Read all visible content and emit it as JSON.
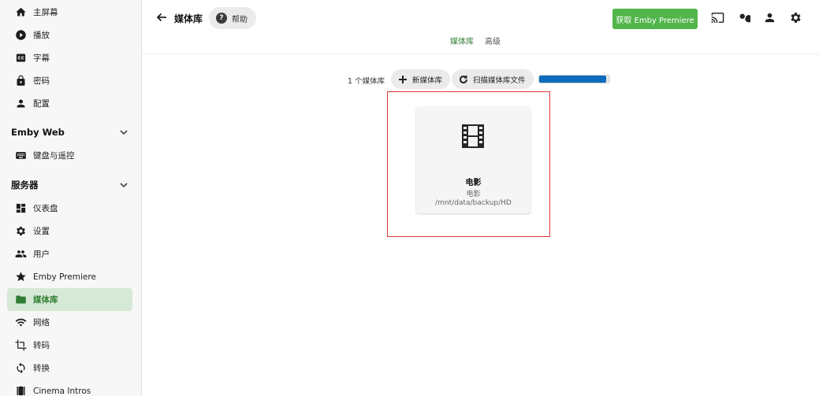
{
  "sidebar": {
    "top_items": [
      {
        "label": "主屏幕",
        "icon": "home-icon"
      },
      {
        "label": "播放",
        "icon": "play-circle-icon"
      },
      {
        "label": "字幕",
        "icon": "subtitles-icon"
      },
      {
        "label": "密码",
        "icon": "lock-icon"
      },
      {
        "label": "配置",
        "icon": "person-icon"
      }
    ],
    "section_emby_web": {
      "title": "Emby Web",
      "items": [
        {
          "label": "键盘与遥控",
          "icon": "keyboard-icon"
        }
      ]
    },
    "section_server": {
      "title": "服务器",
      "items": [
        {
          "label": "仪表盘",
          "icon": "dashboard-icon"
        },
        {
          "label": "设置",
          "icon": "gear-icon"
        },
        {
          "label": "用户",
          "icon": "people-icon"
        },
        {
          "label": "Emby Premiere",
          "icon": "star-icon"
        },
        {
          "label": "媒体库",
          "icon": "folder-icon",
          "active": true
        },
        {
          "label": "网络",
          "icon": "wifi-icon"
        },
        {
          "label": "转码",
          "icon": "crop-icon"
        },
        {
          "label": "转换",
          "icon": "sync-icon"
        },
        {
          "label": "Cinema Intros",
          "icon": "film-icon"
        }
      ]
    }
  },
  "header": {
    "title": "媒体库",
    "help_label": "帮助",
    "premiere_button": "获取 Emby Premiere",
    "icons": [
      "cast-icon",
      "search-icon",
      "user-icon",
      "gear-icon"
    ],
    "tabs": [
      {
        "label": "媒体库",
        "active": true
      },
      {
        "label": "高级",
        "active": false
      }
    ]
  },
  "toolbar": {
    "count_label": "1 个媒体库",
    "new_library": "新媒体库",
    "scan_library": "扫描媒体库文件",
    "scan_progress": 0.95
  },
  "library_card": {
    "name": "电影",
    "type": "电影",
    "path": "/mnt/data/backup/HD"
  },
  "colors": {
    "accent": "#52b54b",
    "active_text": "#2e7d32",
    "active_bg": "#d6e9d6",
    "progress": "#0f6bbd",
    "highlight": "#e03434"
  }
}
